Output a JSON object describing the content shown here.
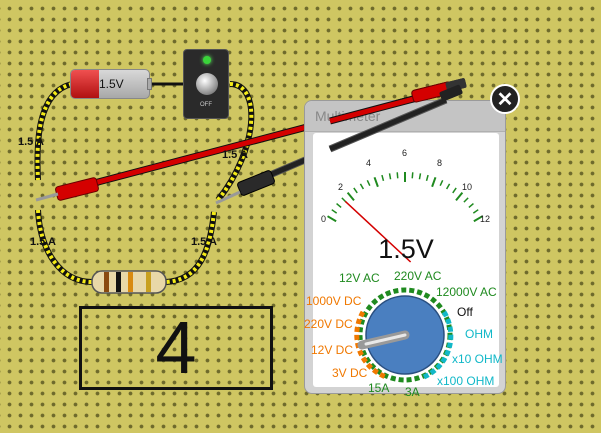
{
  "circuit": {
    "battery_label": "1.5V",
    "switch_label": "OFF",
    "ammeter_labels": [
      "1.5 A",
      "1.5 A",
      "1.5 A",
      "1.5 A"
    ]
  },
  "step_number": "4",
  "multimeter": {
    "title": "Multimeter",
    "reading": "1.5V",
    "scale_ticks": [
      "0",
      "2",
      "4",
      "6",
      "8",
      "10",
      "12"
    ],
    "needle_value": 1.5,
    "scale_max": 12,
    "dial_settings": {
      "ac_12v": "12V AC",
      "ac_220v": "220V AC",
      "ac_12000v": "12000V AC",
      "off": "Off",
      "dc_1000v": "1000V DC",
      "dc_220v": "220V DC",
      "dc_12v": "12V DC",
      "dc_3v": "3V DC",
      "amp_15a": "15A",
      "amp_3a": "3A",
      "ohm": "OHM",
      "ohm_x10": "x10 OHM",
      "ohm_x100": "x100 OHM"
    },
    "selected_setting": "3V DC",
    "close_icon": "close-icon"
  },
  "colors": {
    "board": "#cfc662",
    "wire": "#f5ec16",
    "probe_red": "#d40000",
    "probe_black": "#222222",
    "ac_color": "#1f8a1f",
    "dc_color": "#f07800",
    "ohm_color": "#11b8c8"
  }
}
